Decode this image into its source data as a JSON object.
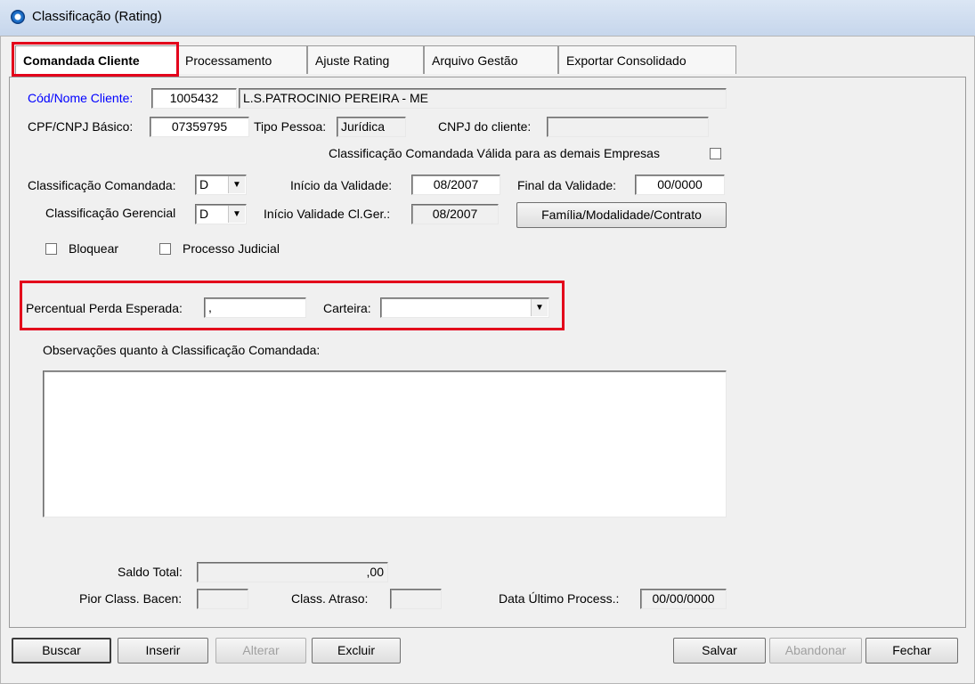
{
  "window": {
    "title": "Classificação (Rating)"
  },
  "tabs": [
    {
      "label": "Comandada Cliente"
    },
    {
      "label": "Processamento"
    },
    {
      "label": "Ajuste Rating"
    },
    {
      "label": "Arquivo Gestão"
    },
    {
      "label": "Exportar Consolidado"
    }
  ],
  "client": {
    "cod_nome_label": "Cód/Nome Cliente:",
    "cod": "1005432",
    "nome": "L.S.PATROCINIO PEREIRA - ME",
    "cpf_cnpj_label": "CPF/CNPJ Básico:",
    "cpf_cnpj": "07359795",
    "tipo_pessoa_label": "Tipo Pessoa:",
    "tipo_pessoa": "Jurídica",
    "cnpj_cliente_label": "CNPJ do cliente:",
    "cnpj_cliente": ""
  },
  "classification": {
    "valida_label": "Classificação Comandada Válida para as demais Empresas",
    "comandada_label": "Classificação Comandada:",
    "comandada_value": "D",
    "inicio_validade_label": "Início da Validade:",
    "inicio_validade": "08/2007",
    "final_validade_label": "Final da Validade:",
    "final_validade": "00/0000",
    "gerencial_label": "Classificação Gerencial",
    "gerencial_value": "D",
    "inicio_cl_ger_label": "Início Validade Cl.Ger.:",
    "inicio_cl_ger": "08/2007",
    "familia_button": "Família/Modalidade/Contrato"
  },
  "flags": {
    "bloquear_label": "Bloquear",
    "processo_judicial_label": "Processo Judicial"
  },
  "perda": {
    "percentual_label": "Percentual Perda Esperada:",
    "percentual_value": ",",
    "carteira_label": "Carteira:",
    "carteira_value": ""
  },
  "observacoes": {
    "label": "Observações quanto à Classificação Comandada:"
  },
  "summary": {
    "saldo_total_label": "Saldo Total:",
    "saldo_total": ",00",
    "pior_class_label": "Pior Class. Bacen:",
    "pior_class": "",
    "class_atraso_label": "Class. Atraso:",
    "class_atraso": "",
    "data_ultimo_label": "Data Último Process.:",
    "data_ultimo": "00/00/0000"
  },
  "buttons": {
    "buscar": "Buscar",
    "inserir": "Inserir",
    "alterar": "Alterar",
    "excluir": "Excluir",
    "salvar": "Salvar",
    "abandonar": "Abandonar",
    "fechar": "Fechar"
  },
  "colors": {
    "highlight": "#e3001b",
    "label_blue": "#0000ff"
  }
}
